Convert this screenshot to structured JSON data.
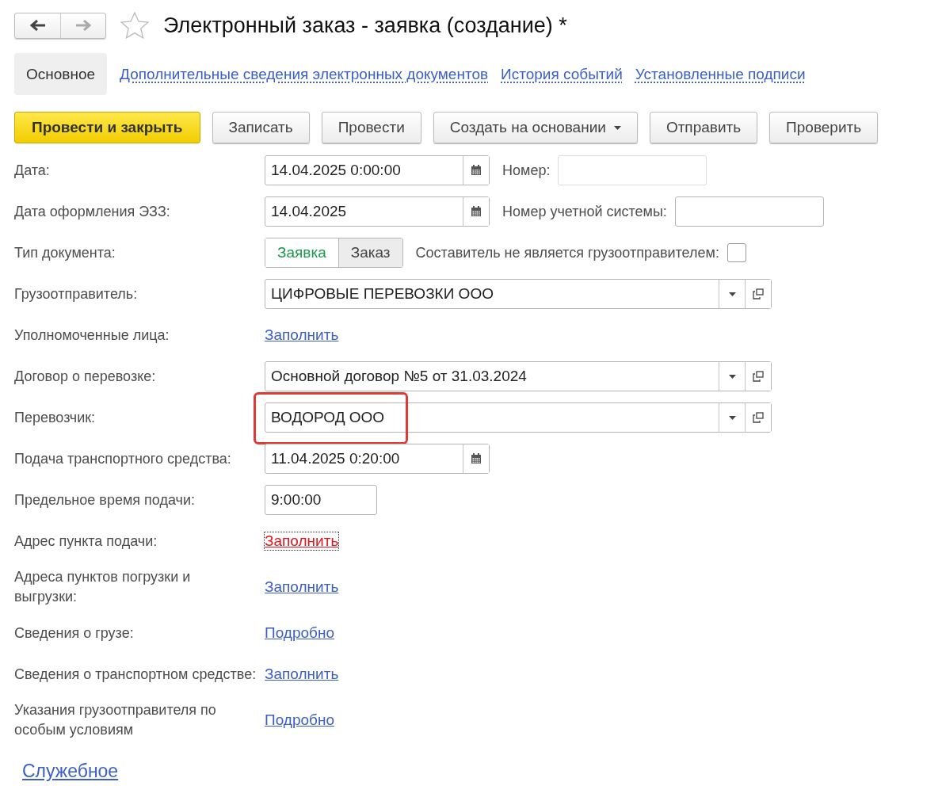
{
  "window": {
    "title": "Электронный заказ - заявка (создание) *"
  },
  "tabs": [
    {
      "label": "Основное",
      "selected": true
    },
    {
      "label": "Дополнительные сведения электронных документов",
      "selected": false
    },
    {
      "label": "История событий",
      "selected": false
    },
    {
      "label": "Установленные подписи",
      "selected": false
    }
  ],
  "toolbar": [
    {
      "label": "Провести и закрыть",
      "kind": "default"
    },
    {
      "label": "Записать",
      "kind": "normal"
    },
    {
      "label": "Провести",
      "kind": "normal"
    },
    {
      "label": "Создать на основании",
      "kind": "menu"
    },
    {
      "label": "Отправить",
      "kind": "normal"
    },
    {
      "label": "Проверить",
      "kind": "normal"
    }
  ],
  "fields": [
    {
      "kind": "date",
      "label": "Дата:",
      "value": "14.04.2025  0:00:00",
      "extra": {
        "label": "Номер:",
        "disabled": true
      }
    },
    {
      "kind": "date",
      "label": "Дата оформления ЭЗЗ:",
      "value": "14.04.2025",
      "extra": {
        "label": "Номер учетной системы:",
        "disabled": false
      }
    },
    {
      "kind": "toggle",
      "label": "Тип документа:",
      "options": [
        {
          "label": "Заявка",
          "selected": true
        },
        {
          "label": "Заказ",
          "selected": false
        }
      ],
      "checkbox": {
        "label": "Составитель не является грузоотправителем:",
        "checked": false
      }
    },
    {
      "kind": "ref",
      "label": "Грузоотправитель:",
      "value": "ЦИФРОВЫЕ ПЕРЕВОЗКИ ООО",
      "highlighted": false
    },
    {
      "kind": "link",
      "label": "Уполномоченные лица:",
      "link": "Заполнить",
      "error": false,
      "focused": false
    },
    {
      "kind": "ref",
      "label": "Договор о перевозке:",
      "value": "Основной договор №5 от 31.03.2024",
      "highlighted": false
    },
    {
      "kind": "ref",
      "label": "Перевозчик:",
      "value": "ВОДОРОД ООО",
      "highlighted": true
    },
    {
      "kind": "date",
      "label": "Подача транспортного средства:",
      "value": "11.04.2025  0:20:00"
    },
    {
      "kind": "time",
      "label": "Предельное время подачи:",
      "value": "9:00:00"
    },
    {
      "kind": "link",
      "label": "Адрес пункта подачи:",
      "link": "Заполнить",
      "error": true,
      "focused": true
    },
    {
      "kind": "link",
      "label": "Адреса пунктов погрузки и выгрузки:",
      "link": "Заполнить",
      "error": false,
      "focused": false
    },
    {
      "kind": "link",
      "label": "Сведения о грузе:",
      "link": "Подробно",
      "error": false,
      "focused": false
    },
    {
      "kind": "link",
      "label": "Сведения о транспортном средстве:",
      "link": "Заполнить",
      "error": false,
      "focused": false
    },
    {
      "kind": "link",
      "label": "Указания грузоотправителя по особым условиям",
      "link": "Подробно",
      "error": false,
      "focused": false
    }
  ],
  "footer_link": "Служебное"
}
